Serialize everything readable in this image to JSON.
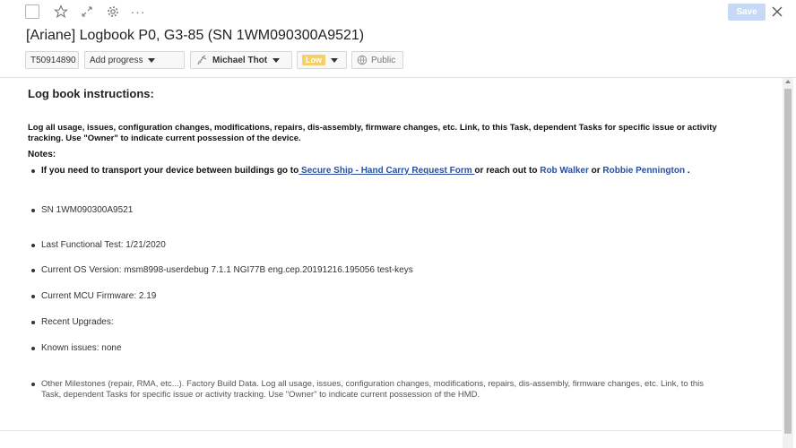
{
  "toolbar": {
    "save_label": "Save",
    "more_label": "···"
  },
  "task": {
    "title": "[Ariane] Logbook P0, G3-85 (SN 1WM090300A9521)",
    "id": "T50914890",
    "progress_label": "Add progress",
    "owner": "Michael Thot",
    "priority": "Low",
    "visibility": "Public"
  },
  "body": {
    "heading": "Log book instructions:",
    "intro": "Log all usage, issues, configuration changes, modifications, repairs, dis-assembly, firmware changes, etc. Link, to this Task, dependent Tasks for specific issue or activity tracking. Use \"Owner\" to indicate current possession of the device.",
    "notes_label": "Notes:",
    "transport": {
      "before": "If you need to transport your device between buildings go to",
      "link": " Secure Ship - Hand Carry Request Form ",
      "middle": "or reach out to ",
      "person1": "Rob Walker",
      "or": " or ",
      "person2": "Robbie Pennington",
      "end": " ."
    },
    "items": [
      "SN 1WM090300A9521",
      "Last Functional Test: 1/21/2020",
      "Current OS Version: msm8998-userdebug 7.1.1 NGI77B eng.cep.20191216.195056 test-keys",
      "Current MCU Firmware: 2.19",
      "Recent Upgrades:",
      "Known issues: none",
      "Other Milestones (repair, RMA, etc...). Factory Build Data. Log all usage, issues, configuration changes, modifications, repairs, dis-assembly, firmware changes, etc. Link, to this Task, dependent Tasks for specific issue or activity tracking. Use \"Owner\" to indicate current possession of the HMD."
    ]
  }
}
